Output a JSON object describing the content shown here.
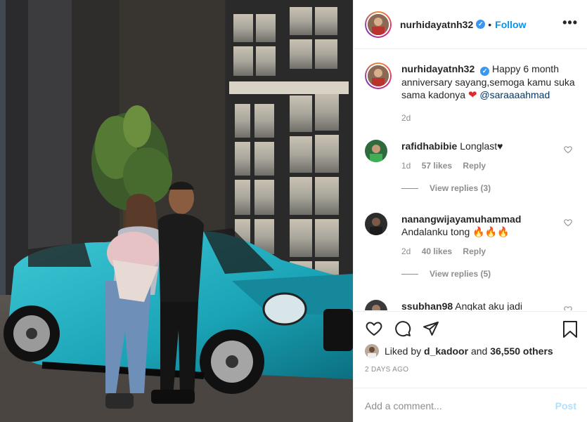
{
  "header": {
    "username": "nurhidayatnh32",
    "verified_mark": "✓",
    "separator": "•",
    "follow_label": "Follow",
    "more_label": "•••"
  },
  "caption": {
    "username": "nurhidayatnh32",
    "text": "Happy 6 month anniversary sayang,semoga kamu suka sama kadonya",
    "emoji": "❤",
    "mention": "@saraaaahmad",
    "time": "2d"
  },
  "comments": [
    {
      "username": "rafidhabibie",
      "text": "Longlast♥",
      "age": "1d",
      "likes": "57 likes",
      "reply_label": "Reply",
      "view_replies": "View replies (3)"
    },
    {
      "username": "nanangwijayamuhammad",
      "text": "Andalanku tong 🔥🔥🔥",
      "age": "2d",
      "likes": "40 likes",
      "reply_label": "Reply",
      "view_replies": "View replies (5)"
    },
    {
      "username": "ssubhan98",
      "text": "Angkat aku jadi"
    }
  ],
  "likes": {
    "prefix": "Liked by",
    "user": "d_kadoor",
    "middle": "and",
    "count": "36,550 others"
  },
  "posted_time": "2 DAYS AGO",
  "add_comment": {
    "placeholder": "Add a comment...",
    "post_label": "Post"
  },
  "icons": {
    "like": "heart-icon",
    "comment": "comment-icon",
    "share": "share-icon",
    "save": "bookmark-icon",
    "more": "more-icon"
  },
  "colors": {
    "accent": "#0095f6",
    "verified": "#3897f0",
    "muted": "#8e8e8e",
    "post_disabled": "#b2dffc",
    "car": "#1fa6b8"
  }
}
